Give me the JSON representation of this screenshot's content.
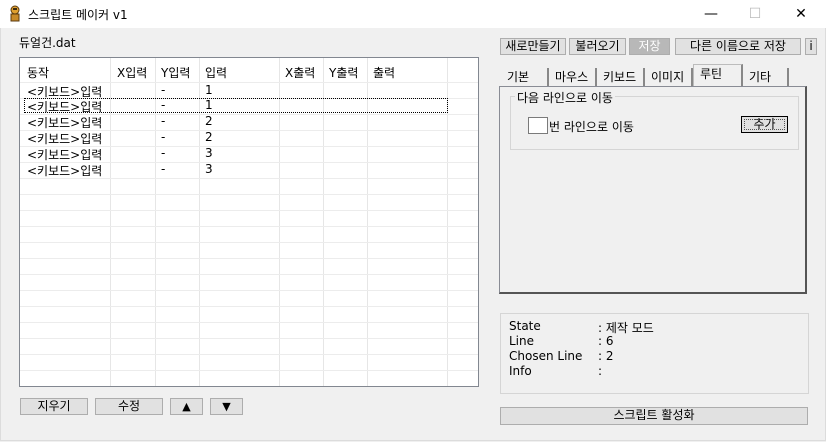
{
  "window": {
    "title": "스크립트 메이커 v1",
    "minimize": "—",
    "maximize": "☐",
    "close": "✕"
  },
  "file_label": "듀얼건.dat",
  "list": {
    "columns": [
      "동작",
      "X입력",
      "Y입력",
      "입력",
      "X출력",
      "Y출력",
      "출력"
    ],
    "rows": [
      {
        "action": "<키보드>입력",
        "y_input": "-",
        "input": "1"
      },
      {
        "action": "<키보드>입력",
        "y_input": "-",
        "input": "1"
      },
      {
        "action": "<키보드>입력",
        "y_input": "-",
        "input": "2"
      },
      {
        "action": "<키보드>입력",
        "y_input": "-",
        "input": "2"
      },
      {
        "action": "<키보드>입력",
        "y_input": "-",
        "input": "3"
      },
      {
        "action": "<키보드>입력",
        "y_input": "-",
        "input": "3"
      }
    ]
  },
  "bottom_buttons": {
    "delete": "지우기",
    "edit": "수정",
    "up": "▲",
    "down": "▼"
  },
  "toolbar": {
    "new": "새로만들기",
    "load": "불러오기",
    "save": "저장",
    "save_as": "다른 이름으로 저장",
    "info": "i"
  },
  "tabs": [
    "기본",
    "마우스",
    "키보드",
    "이미지",
    "루틴",
    "기타"
  ],
  "routine": {
    "group_title": "다음 라인으로 이동",
    "line_suffix": "번 라인으로 이동",
    "add_button": "추가",
    "line_value": ""
  },
  "status": {
    "state_label": "State",
    "state_value": ": 제작 모드",
    "line_label": "Line",
    "line_value": ": 6",
    "chosen_label": "Chosen Line",
    "chosen_value": ": 2",
    "info_label": "Info",
    "info_value": ":"
  },
  "activate_button": "스크립트 활성화"
}
